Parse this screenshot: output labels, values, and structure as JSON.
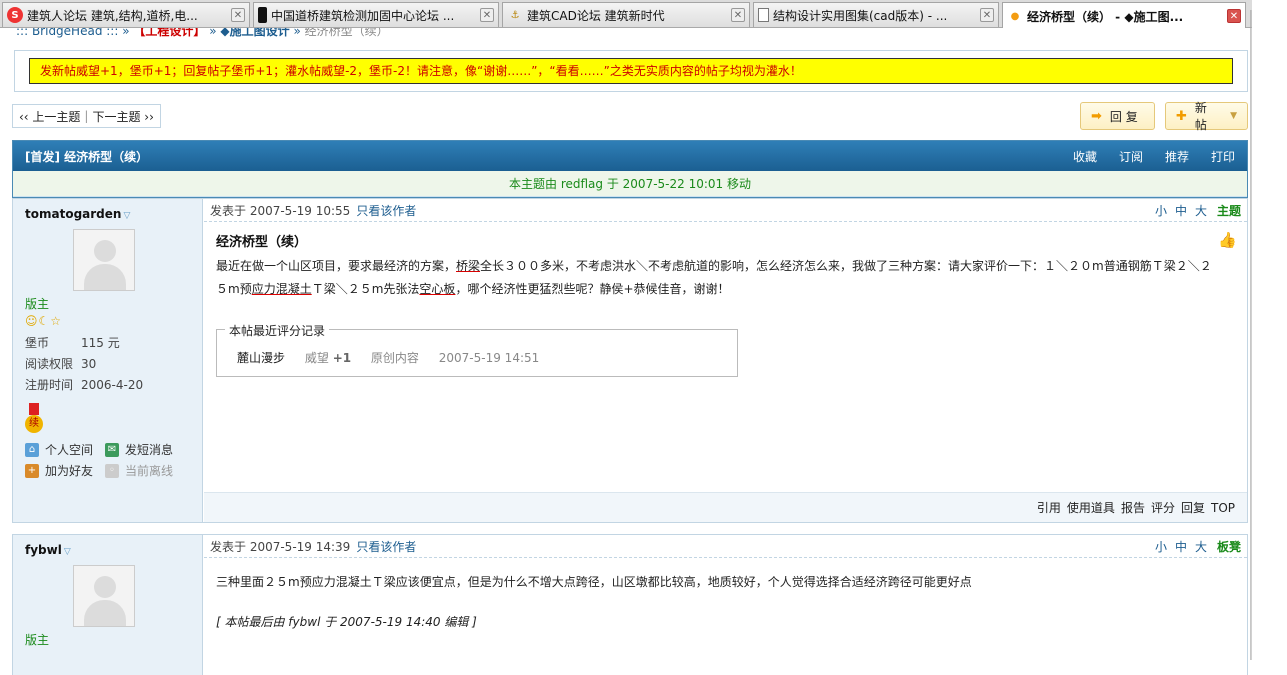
{
  "tabs": [
    {
      "label": "建筑人论坛 建筑,结构,道桥,电...",
      "icon": "forum-s-icon",
      "active": false
    },
    {
      "label": "中国道桥建筑检测加固中心论坛 ...",
      "icon": "dark-page-icon",
      "active": false
    },
    {
      "label": "建筑CAD论坛 建筑新时代",
      "icon": "anchor-icon",
      "active": false
    },
    {
      "label": "结构设计实用图集(cad版本) - ...",
      "icon": "document-icon",
      "active": false
    },
    {
      "label": "经济桥型（续） - ◆施工图...",
      "icon": "orange-dot-icon",
      "active": true
    }
  ],
  "breadcrumb": {
    "home": "::: BridgeHead :::",
    "section": "【工程设计】",
    "subsection": "◆施工图设计",
    "current": "经济桥型（续）",
    "sep": "»"
  },
  "notice": "发新帖威望+1，堡币+1；回复帖子堡币+1；灌水帖威望-2，堡币-2！请注意，像“谢谢……”，“看看……”之类无实质内容的帖子均视为灌水！",
  "pager": {
    "prev": "‹‹ 上一主题",
    "divider": "|",
    "next": "下一主题 ››"
  },
  "buttons": {
    "reply": "回 复",
    "newpost": "新 帖"
  },
  "thread": {
    "title": "[首发] 经济桥型（续）",
    "actions": [
      "收藏",
      "订阅",
      "推荐",
      "打印"
    ],
    "moved_note": "本主题由 redflag 于 2007-5-22 10:01 移动"
  },
  "posts": [
    {
      "author": "tomatogarden",
      "role": "版主",
      "stars": "☺☾☆",
      "stats": [
        {
          "k": "堡币",
          "v": "115 元"
        },
        {
          "k": "阅读权限",
          "v": "30"
        },
        {
          "k": "注册时间",
          "v": "2006-4-20"
        }
      ],
      "medal_char": "续",
      "links": [
        "个人空间",
        "发短消息",
        "加为好友",
        "当前离线"
      ],
      "posted": "发表于 2007-5-19 10:55",
      "only_author": "只看该作者",
      "sizes": [
        "小",
        "中",
        "大"
      ],
      "floor": "主题",
      "title": "经济桥型（续）",
      "text_a": "最近在做一个山区项目，要求最经济的方案，",
      "text_b": "桥梁",
      "text_c": "全长３００多米，不考虑洪水＼不考虑航道的影响，怎么经济怎么来，我做了三种方案：请大家评价一下：１＼２０m普通钢筋Ｔ梁２＼２５m预",
      "text_d": "应力混凝土",
      "text_e": "Ｔ梁＼２５m先张法",
      "text_f": "空心板",
      "text_g": "，哪个经济性更猛烈些呢？静侯+恭候佳音，谢谢！",
      "rating": {
        "legend": "本帖最近评分记录",
        "who": "麓山漫步",
        "points_label": "威望",
        "points": "+1",
        "reason": "原创内容",
        "time": "2007-5-19 14:51"
      },
      "footer": [
        "引用",
        "使用道具",
        "报告",
        "评分",
        "回复",
        "TOP"
      ]
    },
    {
      "author": "fybwl",
      "role": "版主",
      "posted": "发表于 2007-5-19 14:39",
      "only_author": "只看该作者",
      "sizes": [
        "小",
        "中",
        "大"
      ],
      "floor": "板凳",
      "text": "三种里面２５m预应力混凝土Ｔ梁应该便宜点，但是为什么不增大点跨径，山区墩都比较高，地质较好，个人觉得选择合适经济跨径可能更好点",
      "edit_note": "[ 本帖最后由 fybwl 于 2007-5-19 14:40 编辑 ]"
    }
  ],
  "colors": {
    "header_blue": "#1b5f92",
    "notice_yellow": "#ffff00",
    "moved_green": "#1a8a1a",
    "author_bg": "#e8f1f8"
  }
}
